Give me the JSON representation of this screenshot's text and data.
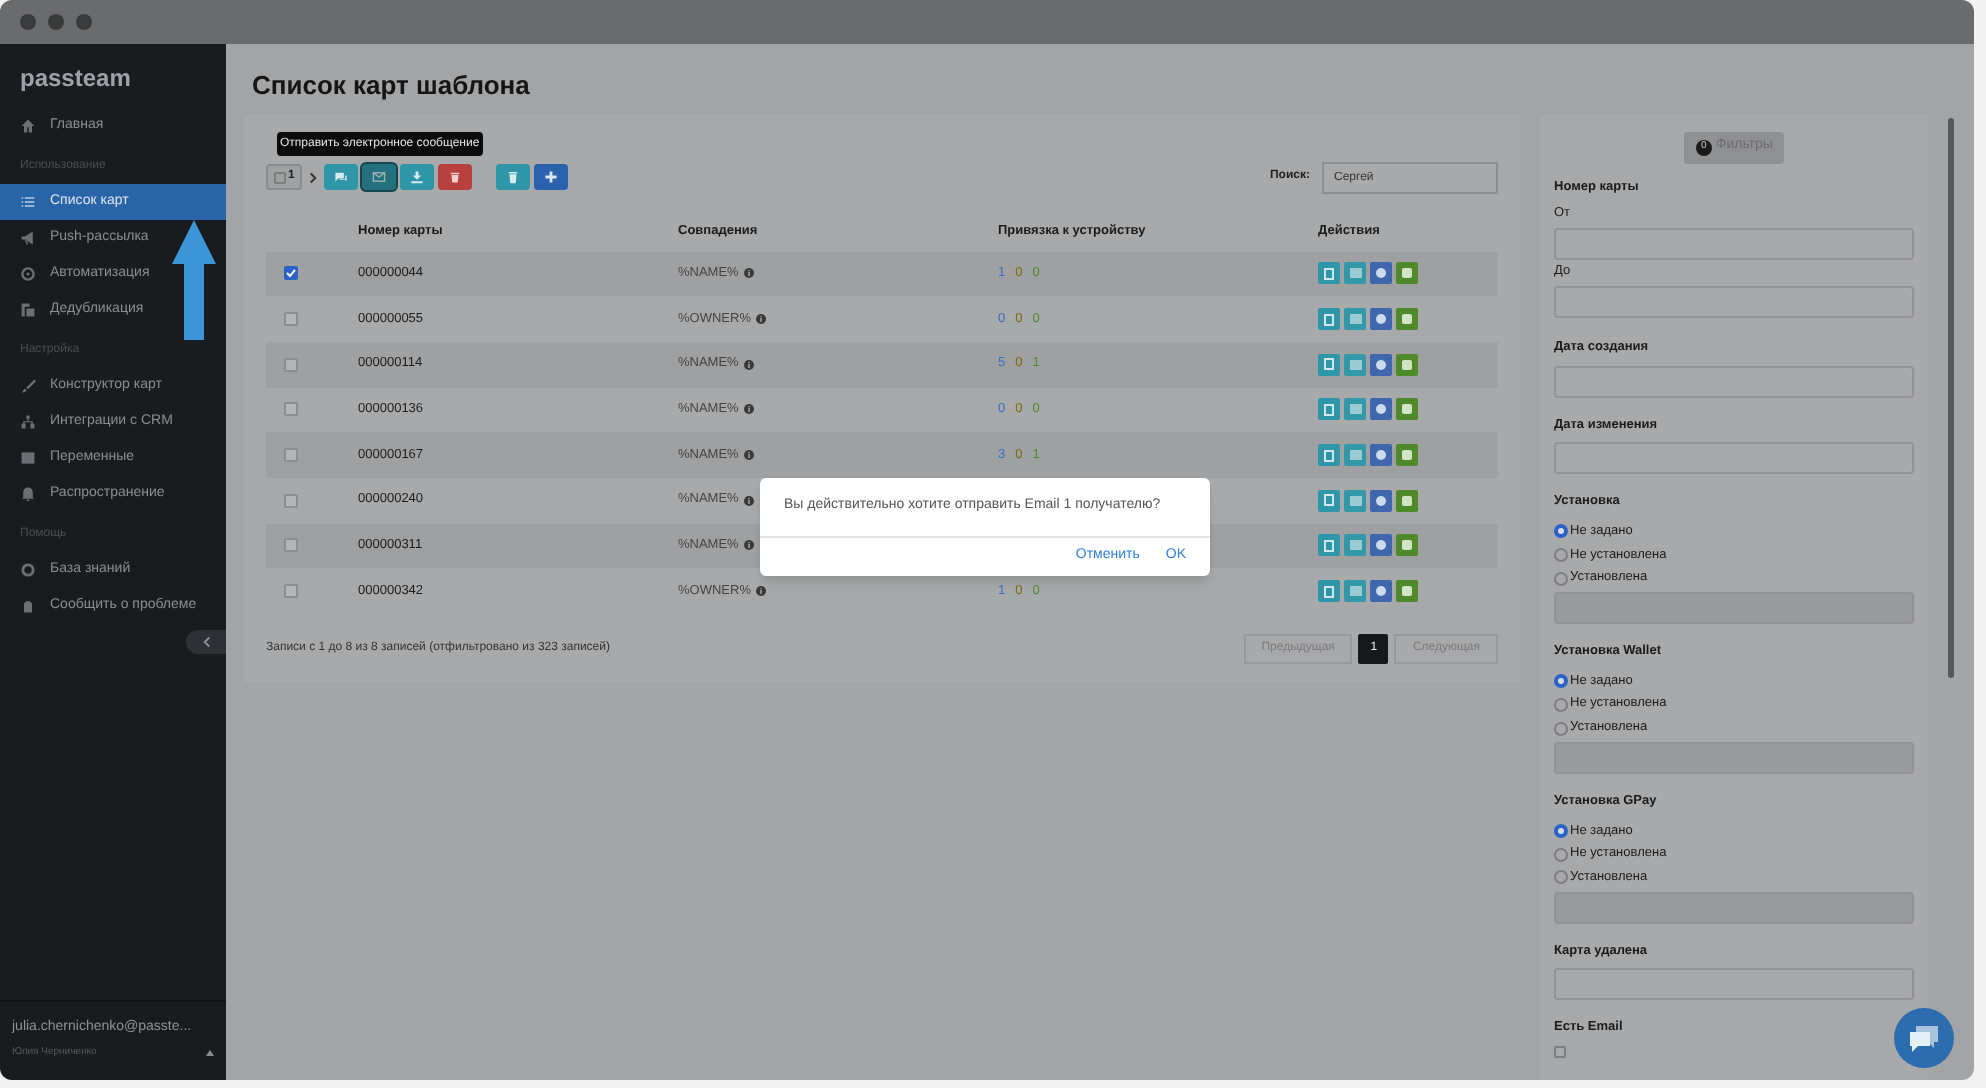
{
  "sidebar": {
    "logo": "passteam",
    "sections": [
      {
        "items": [
          {
            "label": "Главная",
            "selected": false
          }
        ]
      },
      {
        "heading": "Использование",
        "items": [
          {
            "label": "Список карт",
            "selected": true
          },
          {
            "label": "Push-рассылка",
            "selected": false
          },
          {
            "label": "Автоматизация",
            "selected": false
          },
          {
            "label": "Дедубликация",
            "selected": false
          }
        ]
      },
      {
        "heading": "Настройка",
        "items": [
          {
            "label": "Конструктор карт",
            "selected": false
          },
          {
            "label": "Интеграции с CRM",
            "selected": false
          },
          {
            "label": "Переменные",
            "selected": false
          },
          {
            "label": "Распространение",
            "selected": false
          }
        ]
      },
      {
        "heading": "Помощь",
        "items": [
          {
            "label": "База знаний",
            "selected": false
          },
          {
            "label": "Сообщить о проблеме",
            "selected": false
          }
        ]
      }
    ],
    "user": {
      "email": "julia.chernichenko@passte...",
      "name": "Юлия Черниченко"
    }
  },
  "page_title": "Список карт шаблона",
  "toolbar": {
    "selected_count": "1",
    "buttons": [
      {
        "kind": "chat",
        "selected": false
      },
      {
        "kind": "email",
        "selected": true
      },
      {
        "kind": "download",
        "selected": false
      },
      {
        "kind": "delete",
        "selected": false
      },
      {
        "kind": "archive",
        "selected": false
      },
      {
        "kind": "add",
        "selected": false
      }
    ]
  },
  "tooltip": "Отправить электронное сообщение",
  "search": {
    "label": "Поиск:",
    "value": "Сергей"
  },
  "table": {
    "columns": [
      "Номер карты",
      "Совпадения",
      "Привязка к устройству",
      "Действия"
    ],
    "rows": [
      {
        "checked": true,
        "card_number": "000000044",
        "match": "%NAME%",
        "device": [
          {
            "value": "1",
            "color": "#3a6fc4"
          },
          {
            "value": "0",
            "color": "#7a6a08"
          },
          {
            "value": "0",
            "color": "#4f8a2a"
          }
        ]
      },
      {
        "checked": false,
        "card_number": "000000055",
        "match": "%OWNER%",
        "device": [
          {
            "value": "0",
            "color": "#3a6fc4"
          },
          {
            "value": "0",
            "color": "#7a6a08"
          },
          {
            "value": "0",
            "color": "#4f8a2a"
          }
        ]
      },
      {
        "checked": false,
        "card_number": "000000114",
        "match": "%NAME%",
        "device": [
          {
            "value": "5",
            "color": "#3a6fc4"
          },
          {
            "value": "0",
            "color": "#7a6a08"
          },
          {
            "value": "1",
            "color": "#4f8a2a"
          }
        ]
      },
      {
        "checked": false,
        "card_number": "000000136",
        "match": "%NAME%",
        "device": [
          {
            "value": "0",
            "color": "#3a6fc4"
          },
          {
            "value": "0",
            "color": "#7a6a08"
          },
          {
            "value": "0",
            "color": "#4f8a2a"
          }
        ]
      },
      {
        "checked": false,
        "card_number": "000000167",
        "match": "%NAME%",
        "device": [
          {
            "value": "3",
            "color": "#3a6fc4"
          },
          {
            "value": "0",
            "color": "#7a6a08"
          },
          {
            "value": "1",
            "color": "#4f8a2a"
          }
        ]
      },
      {
        "checked": false,
        "card_number": "000000240",
        "match": "%NAME%"
      },
      {
        "checked": false,
        "card_number": "000000311",
        "match": "%NAME%"
      },
      {
        "checked": false,
        "card_number": "000000342",
        "match": "%OWNER%",
        "device": [
          {
            "value": "1",
            "color": "#3a6fc4"
          },
          {
            "value": "0",
            "color": "#7a6a08"
          },
          {
            "value": "0",
            "color": "#4f8a2a"
          }
        ]
      }
    ]
  },
  "table_info": "Записи с 1 до 8 из 8 записей (отфильтровано из 323 записей)",
  "pagination": {
    "previous": "Предыдущая",
    "pages": [
      {
        "label": "1",
        "selected": true
      }
    ],
    "next": "Следующая"
  },
  "dialog": {
    "message": "Вы действительно хотите отправить Email 1 получателю?",
    "buttons": [
      "Отменить",
      "OK"
    ]
  },
  "filters": {
    "button": {
      "count": "0",
      "label": "Фильтры"
    },
    "groups": [
      {
        "kind": "range",
        "title": "Номер карты",
        "fields": [
          "От",
          "До"
        ]
      },
      {
        "kind": "input",
        "title": "Дата создания"
      },
      {
        "kind": "input",
        "title": "Дата изменения"
      },
      {
        "kind": "radio",
        "title": "Установка",
        "options": [
          {
            "label": "Не задано",
            "selected": true
          },
          {
            "label": "Не установлена",
            "selected": false
          },
          {
            "label": "Установлена",
            "selected": false
          }
        ]
      },
      {
        "kind": "radio",
        "title": "Установка Wallet",
        "options": [
          {
            "label": "Не задано",
            "selected": true
          },
          {
            "label": "Не установлена",
            "selected": false
          },
          {
            "label": "Установлена",
            "selected": false
          }
        ]
      },
      {
        "kind": "radio",
        "title": "Установка GPay",
        "options": [
          {
            "label": "Не задано",
            "selected": true
          },
          {
            "label": "Не установлена",
            "selected": false
          },
          {
            "label": "Установлена",
            "selected": false
          }
        ]
      },
      {
        "kind": "input",
        "title": "Карта удалена"
      },
      {
        "kind": "checkbox",
        "title": "Есть Email",
        "checked": false
      }
    ]
  }
}
